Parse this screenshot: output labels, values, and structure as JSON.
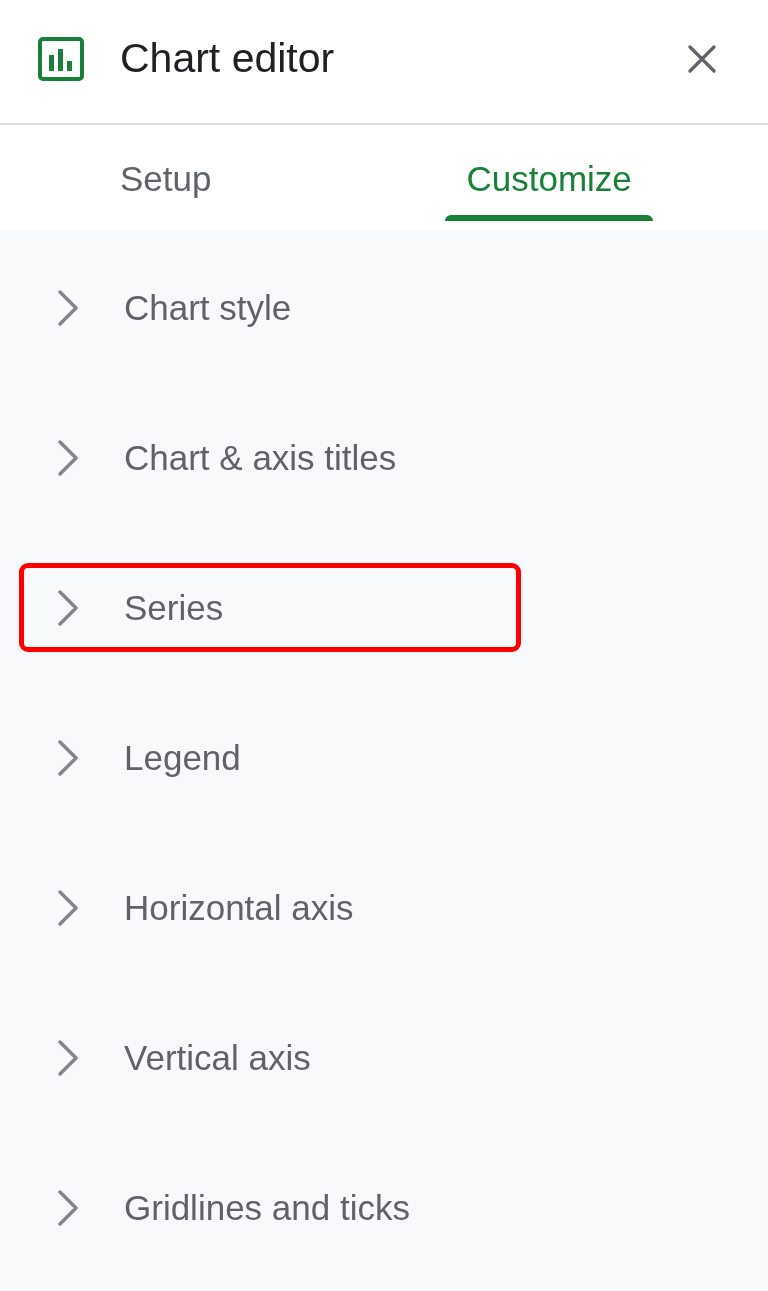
{
  "header": {
    "title": "Chart editor"
  },
  "tabs": [
    {
      "label": "Setup",
      "selected": false
    },
    {
      "label": "Customize",
      "selected": true
    }
  ],
  "sections": [
    {
      "label": "Chart style",
      "expanded": false,
      "highlighted": false
    },
    {
      "label": "Chart & axis titles",
      "expanded": false,
      "highlighted": false
    },
    {
      "label": "Series",
      "expanded": false,
      "highlighted": true
    },
    {
      "label": "Legend",
      "expanded": false,
      "highlighted": false
    },
    {
      "label": "Horizontal axis",
      "expanded": false,
      "highlighted": false
    },
    {
      "label": "Vertical axis",
      "expanded": false,
      "highlighted": false
    },
    {
      "label": "Gridlines and ticks",
      "expanded": false,
      "highlighted": false
    }
  ]
}
